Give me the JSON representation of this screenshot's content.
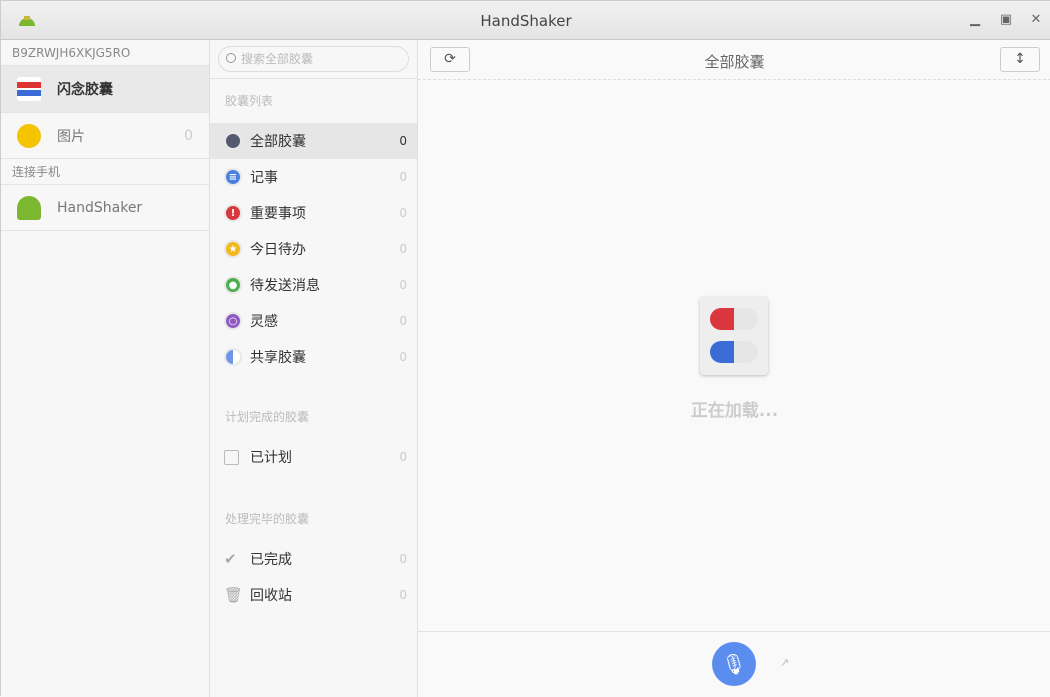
{
  "window": {
    "title": "HandShaker"
  },
  "sidebar": {
    "device_id": "B9ZRWJH6XKJG5RO",
    "items": [
      {
        "label": "闪念胶囊",
        "count": ""
      },
      {
        "label": "图片",
        "count": "0"
      }
    ],
    "connect_header": "连接手机",
    "phone": {
      "label": "HandShaker"
    }
  },
  "list": {
    "search_placeholder": "搜索全部胶囊",
    "section1": "胶囊列表",
    "items": [
      {
        "label": "全部胶囊",
        "count": "0",
        "color": "#555b6e"
      },
      {
        "label": "记事",
        "count": "0",
        "color": "#4a7fe0"
      },
      {
        "label": "重要事项",
        "count": "0",
        "color": "#d9363e"
      },
      {
        "label": "今日待办",
        "count": "0",
        "color": "#f2b81c"
      },
      {
        "label": "待发送消息",
        "count": "0",
        "color": "#4cae4c"
      },
      {
        "label": "灵感",
        "count": "0",
        "color": "#8e5bc2"
      },
      {
        "label": "共享胶囊",
        "count": "0",
        "color": "#6d96e8"
      }
    ],
    "section2": "计划完成的胶囊",
    "planned": {
      "label": "已计划",
      "count": "0"
    },
    "section3": "处理完毕的胶囊",
    "done": {
      "label": "已完成",
      "count": "0"
    },
    "trash": {
      "label": "回收站",
      "count": "0"
    }
  },
  "main": {
    "title": "全部胶囊",
    "loading": "正在加载..."
  }
}
